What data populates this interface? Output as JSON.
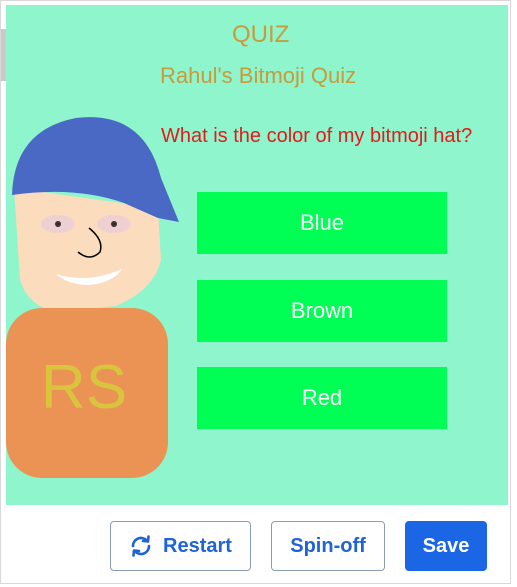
{
  "quiz": {
    "title": "QUIZ",
    "subtitle": "Rahul's Bitmoji Quiz",
    "question": "What is the color of my bitmoji hat?",
    "answers": [
      "Blue",
      "Brown",
      "Red"
    ]
  },
  "avatar": {
    "shirt_initials": "RS",
    "hat_color": "#4a69c4",
    "shirt_color": "#ea9355",
    "skin_color": "#fbdcbd"
  },
  "toolbar": {
    "restart_label": "Restart",
    "restart_icon": "refresh-icon",
    "spinoff_label": "Spin-off",
    "save_label": "Save"
  },
  "colors": {
    "background": "#8ef5cd",
    "answer_button": "#00ff55",
    "title_text": "#c89b3c",
    "question_text": "#e31b1b",
    "save_button": "#1a66e5"
  }
}
